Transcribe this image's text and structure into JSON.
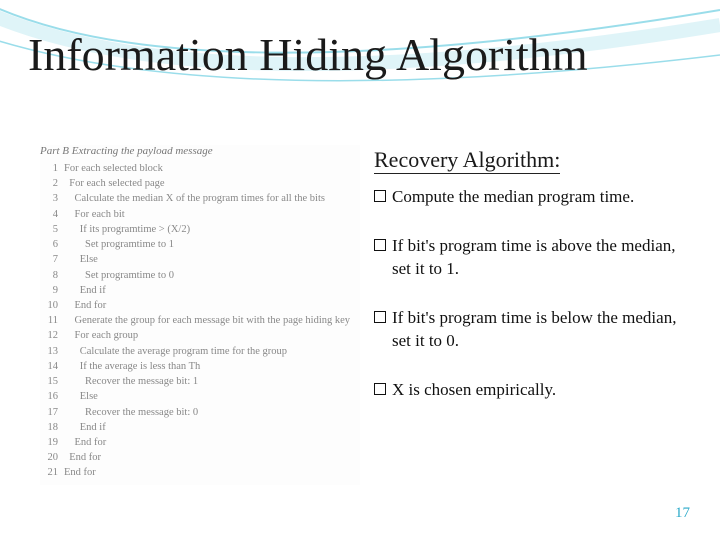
{
  "title": "Information Hiding Algorithm",
  "recovery": {
    "heading": "Recovery Algorithm:",
    "bullets": [
      "Compute the median program time.",
      "If bit's program time is above the median, set it to 1.",
      "If bit's program time is below the median, set it to 0.",
      "X is chosen empirically."
    ]
  },
  "pseudocode": {
    "part_header": "Part B    Extracting the payload message",
    "lines": [
      "For each selected block",
      "  For each selected page",
      "    Calculate the median X of the program times for all the bits",
      "    For each bit",
      "      If its programtime > (X/2)",
      "        Set programtime to 1",
      "      Else",
      "        Set programtime to 0",
      "      End if",
      "    End for",
      "    Generate the group for each message bit with the page hiding key",
      "    For each group",
      "      Calculate the average program time for the group",
      "      If the average is less than Th",
      "        Recover the message bit: 1",
      "      Else",
      "        Recover the message bit: 0",
      "      End if",
      "    End for",
      "  End for",
      "End for"
    ]
  },
  "page_number": "17"
}
